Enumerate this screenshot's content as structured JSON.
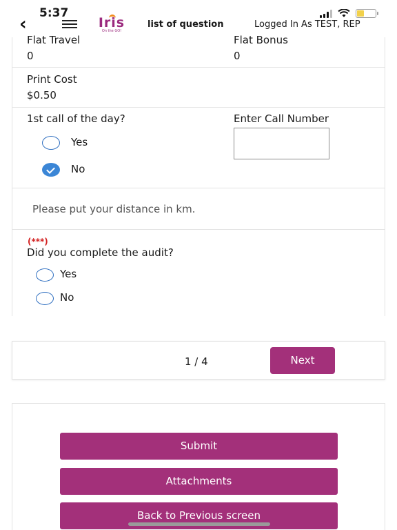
{
  "status_bar": {
    "time": "5:37"
  },
  "header": {
    "logo_text": "Iris",
    "logo_subtext": "On the GO!",
    "title": "list of question",
    "logged_in": "Logged In As TEST, REP"
  },
  "form": {
    "flat_travel": {
      "label": "Flat Travel",
      "value": "0"
    },
    "flat_bonus": {
      "label": "Flat Bonus",
      "value": "0"
    },
    "print_cost": {
      "label": "Print Cost",
      "value": "$0.50"
    },
    "first_call": {
      "label": "1st call of the day?",
      "options": [
        {
          "label": "Yes",
          "selected": false
        },
        {
          "label": "No",
          "selected": true
        }
      ]
    },
    "call_number": {
      "label": "Enter Call Number",
      "value": ""
    },
    "distance_hint": "Please put your distance in km.",
    "audit": {
      "required_marker": "(***)",
      "question": "Did you complete the audit?",
      "options": [
        {
          "label": "Yes",
          "selected": false
        },
        {
          "label": "No",
          "selected": false
        }
      ]
    }
  },
  "pagination": {
    "indicator": "1 / 4",
    "next_label": "Next"
  },
  "actions": {
    "submit": "Submit",
    "attachments": "Attachments",
    "back": "Back to Previous screen"
  },
  "colors": {
    "brand": "#a3307a",
    "radio_checked": "#3b86d6",
    "required": "#d32222"
  }
}
